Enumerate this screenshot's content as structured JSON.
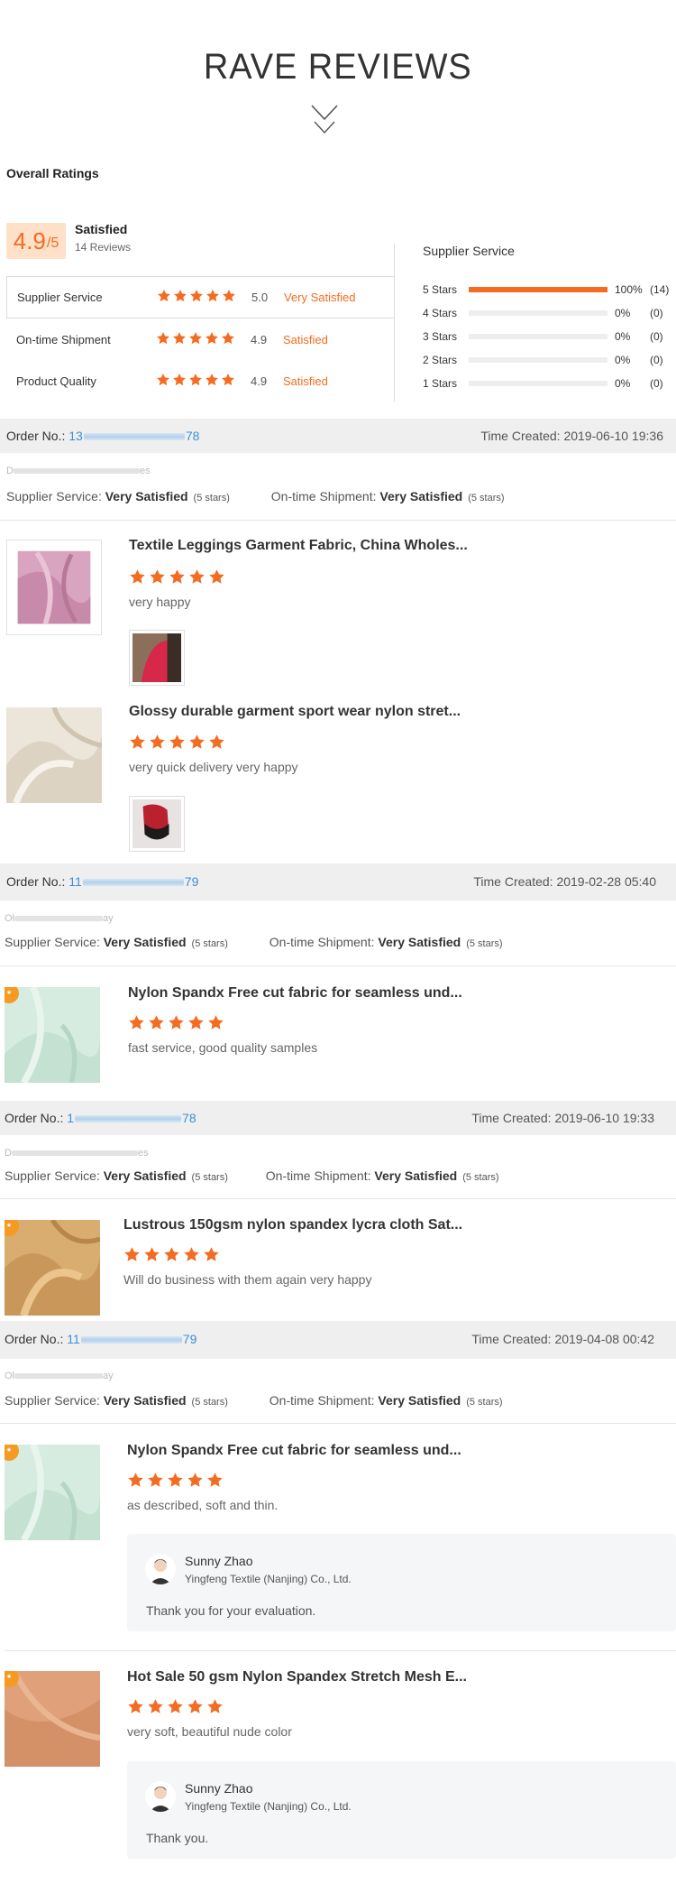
{
  "section_title": "RAVE REVIEWS",
  "overall": {
    "heading": "Overall Ratings",
    "score": "4.9",
    "score_suffix": "/5",
    "label": "Satisfied",
    "reviews": "14 Reviews",
    "rows": [
      {
        "label": "Supplier Service",
        "stars": 5,
        "value": "5.0",
        "status": "Very Satisfied"
      },
      {
        "label": "On-time Shipment",
        "stars": 5,
        "value": "4.9",
        "status": "Satisfied"
      },
      {
        "label": "Product Quality",
        "stars": 5,
        "value": "4.9",
        "status": "Satisfied"
      }
    ]
  },
  "supplier_service": {
    "title": "Supplier Service",
    "accent": "#f36c21",
    "distribution": [
      {
        "label": "5 Stars",
        "fraction": 1.0,
        "pct": "100%",
        "count": "(14)"
      },
      {
        "label": "4 Stars",
        "fraction": 0,
        "pct": "0%",
        "count": "(0)"
      },
      {
        "label": "3 Stars",
        "fraction": 0,
        "pct": "0%",
        "count": "(0)"
      },
      {
        "label": "2 Stars",
        "fraction": 0,
        "pct": "0%",
        "count": "(0)"
      },
      {
        "label": "1 Stars",
        "fraction": 0,
        "pct": "0%",
        "count": "(0)"
      }
    ]
  },
  "labels": {
    "order_no": "Order No.:",
    "time_created": "Time Created:",
    "supplier_service": "Supplier Service:",
    "ontime": "On-time Shipment:"
  },
  "orders": [
    {
      "order_prefix": "13",
      "order_suffix": "78",
      "time": "2019-06-10 19:36",
      "buyer_prefix": "D",
      "buyer_suffix": "es",
      "service": "Very Satisfied",
      "service_stars": "(5 stars)",
      "shipment": "Very Satisfied",
      "shipment_stars": "(5 stars)",
      "items": [
        {
          "title": "Textile Leggings Garment Fabric, China Wholes...",
          "comment": "very happy"
        },
        {
          "title": "Glossy durable garment sport wear nylon stret...",
          "comment": "very quick delivery very happy"
        }
      ]
    },
    {
      "order_prefix": "11",
      "order_suffix": "79",
      "time": "2019-02-28 05:40",
      "buyer_prefix": "Ol",
      "buyer_suffix": "ay",
      "service": "Very Satisfied",
      "service_stars": "(5 stars)",
      "shipment": "Very Satisfied",
      "shipment_stars": "(5 stars)",
      "items": [
        {
          "title": "Nylon Spandx Free cut fabric for seamless und...",
          "comment": "fast service, good quality samples"
        }
      ]
    },
    {
      "order_prefix": "1",
      "order_suffix": "78",
      "time": "2019-06-10 19:33",
      "buyer_prefix": "D",
      "buyer_suffix": "es",
      "service": "Very Satisfied",
      "service_stars": "(5 stars)",
      "shipment": "Very Satisfied",
      "shipment_stars": "(5 stars)",
      "items": [
        {
          "title": "Lustrous 150gsm nylon spandex lycra cloth Sat...",
          "comment": "Will do business with them again very happy"
        }
      ]
    },
    {
      "order_prefix": "11",
      "order_suffix": "79",
      "time": "2019-04-08 00:42",
      "buyer_prefix": "Ol",
      "buyer_suffix": "ay",
      "service": "Very Satisfied",
      "service_stars": "(5 stars)",
      "shipment": "Very Satisfied",
      "shipment_stars": "(5 stars)",
      "items": [
        {
          "title": "Nylon Spandx Free cut fabric for seamless und...",
          "comment": "as described, soft and thin.",
          "reply": {
            "name": "Sunny Zhao",
            "company": "Yingfeng Textile (Nanjing) Co., Ltd.",
            "text": "Thank you for your evaluation."
          }
        },
        {
          "title": "Hot Sale 50 gsm Nylon Spandex Stretch Mesh E...",
          "comment": "very soft, beautiful nude color",
          "reply": {
            "name": "Sunny Zhao",
            "company": "Yingfeng Textile (Nanjing) Co., Ltd.",
            "text": "Thank you."
          }
        }
      ]
    }
  ]
}
